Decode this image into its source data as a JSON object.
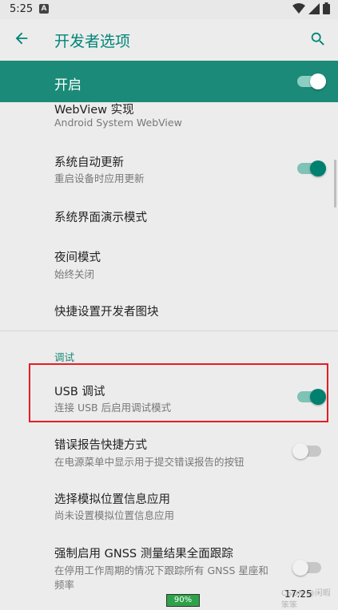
{
  "status_bar": {
    "time": "5:25",
    "notification_glyph": "A",
    "icons": [
      "wifi-icon",
      "signal-icon",
      "battery-icon"
    ]
  },
  "toolbar": {
    "title": "开发者选项",
    "back_icon": "arrow-back-icon",
    "search_icon": "search-icon"
  },
  "master_switch": {
    "label": "开启",
    "state": "on"
  },
  "items": [
    {
      "title": "WebView 实现",
      "subtitle": "Android System WebView"
    },
    {
      "title": "系统自动更新",
      "subtitle": "重启设备时应用更新",
      "toggle": "on"
    },
    {
      "title": "系统界面演示模式"
    },
    {
      "title": "夜间模式",
      "subtitle": "始终关闭"
    },
    {
      "title": "快捷设置开发者图块"
    }
  ],
  "category": "调试",
  "debug_items": [
    {
      "title": "USB 调试",
      "subtitle": "连接 USB 后启用调试模式",
      "toggle": "on"
    },
    {
      "title": "错误报告快捷方式",
      "subtitle": "在电源菜单中显示用于提交错误报告的按钮",
      "toggle": "off"
    },
    {
      "title": "选择模拟位置信息应用",
      "subtitle": "尚未设置模拟位置信息应用"
    },
    {
      "title": "强制启用 GNSS 测量结果全面跟踪",
      "subtitle_line1": "在停用工作周期的情况下跟踪所有 GNSS 星座和",
      "subtitle_line2": "频率",
      "toggle": "off"
    }
  ],
  "bottom_overlay": {
    "battery_percent": "90%",
    "clock": "17:25",
    "watermark": "CSDN @闲暇笨笨"
  },
  "colors": {
    "accent": "#008577",
    "master_bg": "#1b8a78",
    "highlight": "#e51c23"
  }
}
